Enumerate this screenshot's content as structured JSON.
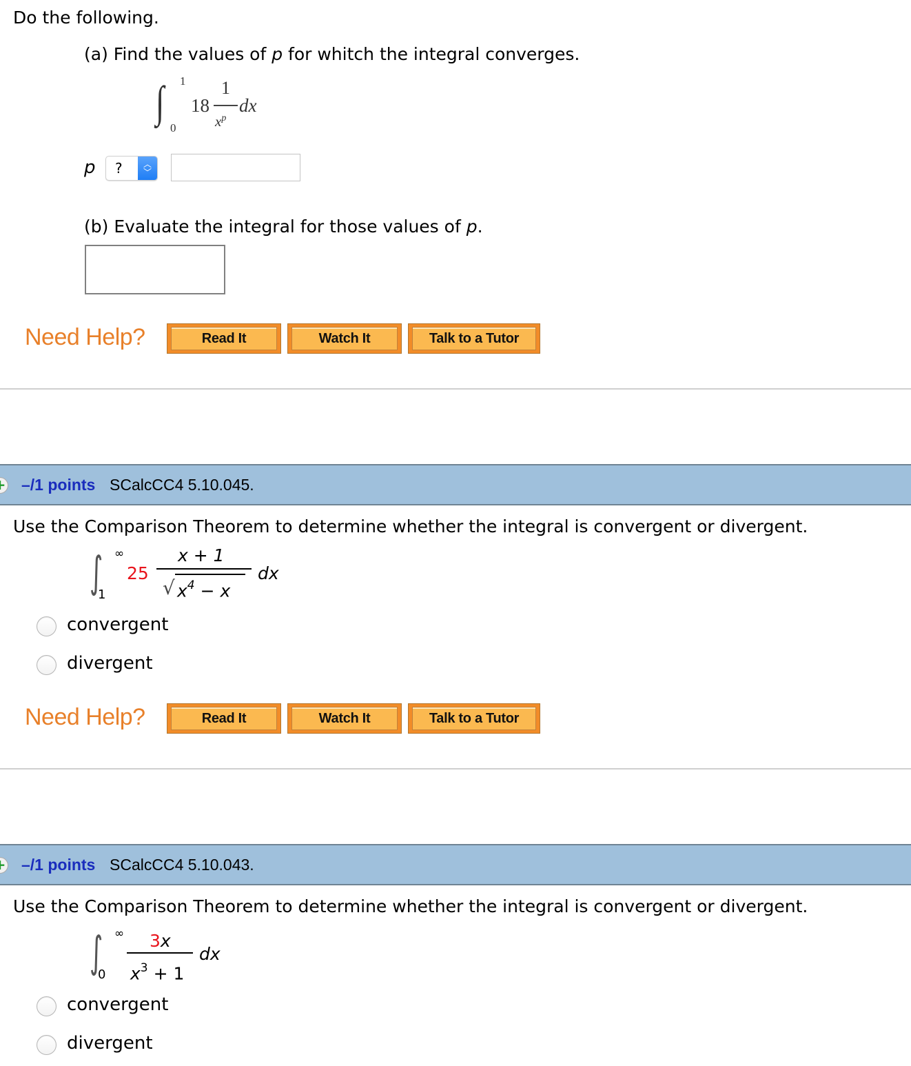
{
  "intro": "Do the following.",
  "part_a": {
    "prompt_prefix": "(a) Find the values of ",
    "prompt_var": "p",
    "prompt_suffix": " for whitch the integral converges.",
    "integral": {
      "lower": "0",
      "upper": "1",
      "coefficient": "18",
      "numerator": "1",
      "denominator_base": "x",
      "denominator_exp": "p",
      "differential": "dx"
    },
    "p_label": "p",
    "select_value": "?",
    "input_value": ""
  },
  "part_b": {
    "prompt_prefix": "(b) Evaluate the integral for those values of ",
    "prompt_var": "p",
    "prompt_suffix": ".",
    "input_value": ""
  },
  "help": {
    "label": "Need Help?",
    "read_it": "Read It",
    "watch_it": "Watch It",
    "talk_to_tutor": "Talk to a Tutor"
  },
  "questions": [
    {
      "points": "–/1 points",
      "id": "SCalcCC4 5.10.045.",
      "prompt": "Use the Comparison Theorem to determine whether the integral is convergent or divergent.",
      "integral": {
        "lower": "1",
        "upper": "∞",
        "coefficient": "25",
        "numerator": "x + 1",
        "radicand_base": "x",
        "radicand_exp": "4",
        "radicand_rest": " − x",
        "differential": "dx"
      },
      "options": [
        "convergent",
        "divergent"
      ],
      "selected": null
    },
    {
      "points": "–/1 points",
      "id": "SCalcCC4 5.10.043.",
      "prompt": "Use the Comparison Theorem to determine whether the integral is convergent or divergent.",
      "integral": {
        "lower": "0",
        "upper": "∞",
        "numerator_coef": "3",
        "numerator_var": "x",
        "denominator_base": "x",
        "denominator_exp": "3",
        "denominator_rest": " + 1",
        "differential": "dx"
      },
      "options": [
        "convergent",
        "divergent"
      ],
      "selected": null
    }
  ],
  "colors": {
    "need_help": "#e8802a",
    "button_fill": "#fbb950",
    "button_border": "#f28c28",
    "question_bar": "#9fc0dc",
    "points_text": "#1a2dbd",
    "highlight_number": "#e8141c",
    "select_arrow": "#1f7ef5"
  }
}
